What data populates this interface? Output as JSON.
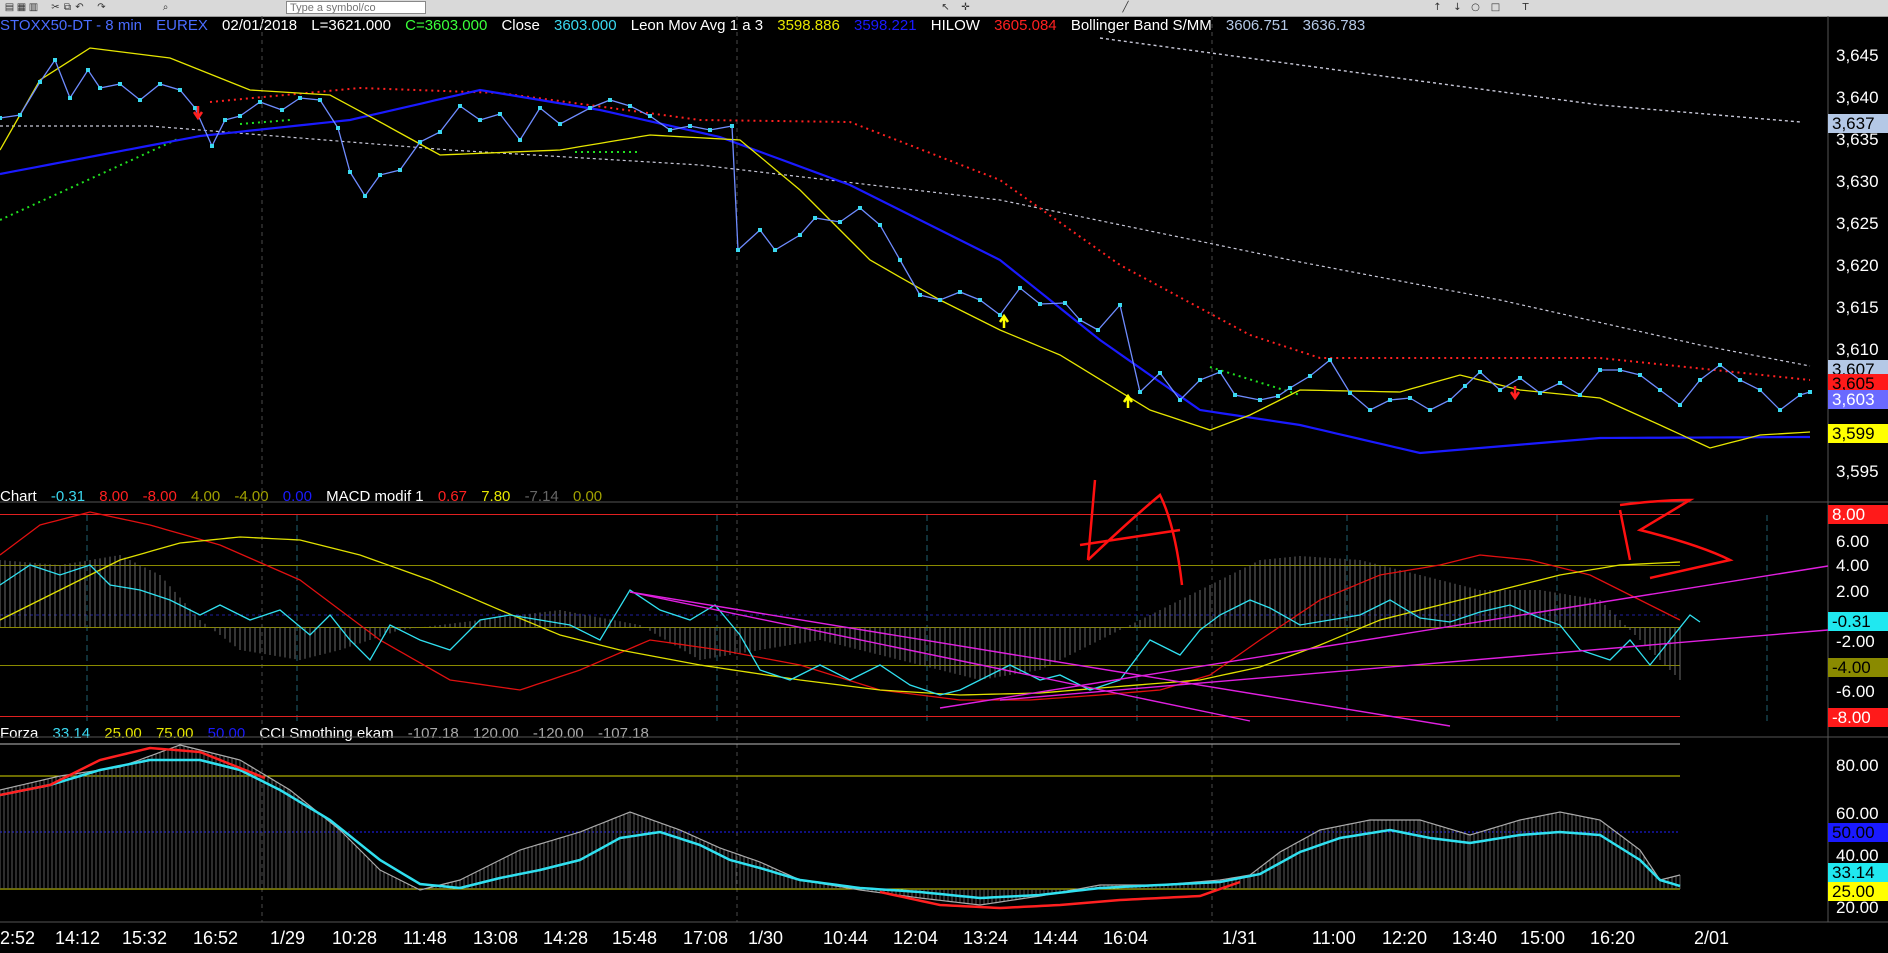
{
  "toolbar": {
    "symbol_placeholder": "Type a symbol/co",
    "tool_icons": [
      "open-icon",
      "save-icon",
      "print-icon",
      "cut-icon",
      "copy-icon",
      "undo-icon",
      "redo-icon",
      "zoom-icon",
      "cursor-icon",
      "crosshair-icon",
      "line-icon",
      "arrow-up-icon",
      "arrow-down-icon",
      "ellipse-icon",
      "rectangle-icon",
      "text-icon"
    ]
  },
  "price_header": {
    "symbol": "STOXX50-DT - 8 min",
    "exchange": "EUREX",
    "date": "02/01/2018",
    "low": "L=3621.000",
    "close_eq": "C=3603.000",
    "close_label": "Close",
    "close_value": "3603.000",
    "ma_name": "Leon Mov Avg 1 a 3",
    "ma_value1": "3598.886",
    "ma_value2": "3598.221",
    "hilow_label": "HILOW",
    "hilow_value": "3605.084",
    "bb_label": "Bollinger Band S/MM",
    "bb_value1": "3606.751",
    "bb_value2": "3636.783"
  },
  "macd_header": {
    "name": "Chart",
    "v1": "-0.31",
    "v2": "8.00",
    "v3": "-8.00",
    "v4": "4.00",
    "v5": "-4.00",
    "v6": "0.00",
    "name2": "MACD modif 1",
    "w1": "0.67",
    "w2": "7.80",
    "w3": "-7.14",
    "w4": "0.00"
  },
  "cci_header": {
    "name": "Forza",
    "v1": "33.14",
    "v2": "25.00",
    "v3": "75.00",
    "v4": "50.00",
    "name2": "CCI Smothing ekam",
    "w1": "-107.18",
    "w2": "120.00",
    "w3": "-120.00",
    "w4": "-107.18"
  },
  "price_axis": [
    "3,645",
    "3,640",
    "3,635",
    "3,630",
    "3,625",
    "3,620",
    "3,615",
    "3,610",
    "3,605",
    "3,600",
    "3,595"
  ],
  "price_badges": [
    {
      "text": "3,637",
      "bg": "#b4c8e6",
      "fg": "#000"
    },
    {
      "text": "3,607",
      "bg": "#b4c8e6",
      "fg": "#000"
    },
    {
      "text": "3,605",
      "bg": "#ff1a1a",
      "fg": "#000"
    },
    {
      "text": "3,603",
      "bg": "#6a6aff",
      "fg": "#fff"
    },
    {
      "text": "3,599",
      "bg": "#ffff00",
      "fg": "#000"
    }
  ],
  "macd_axis": [
    "8.00",
    "6.00",
    "4.00",
    "2.00",
    "-0.31",
    "-2.00",
    "-4.00",
    "-6.00",
    "-8.00"
  ],
  "cci_axis": [
    "80.00",
    "60.00",
    "50.00",
    "40.00",
    "33.14",
    "25.00",
    "20.00"
  ],
  "time_axis": [
    "2:52",
    "14:12",
    "15:32",
    "16:52",
    "1/29",
    "10:28",
    "11:48",
    "13:08",
    "14:28",
    "15:48",
    "17:08",
    "1/30",
    "10:44",
    "12:04",
    "13:24",
    "14:44",
    "16:04",
    "1/31",
    "11:00",
    "12:20",
    "13:40",
    "15:00",
    "16:20",
    "2/01"
  ],
  "annotations": {
    "left": "1A",
    "right": "B"
  },
  "colors": {
    "price_line": "#3ad8f0",
    "ma_fast": "#e6e600",
    "ma_slow": "#1a1aff",
    "hilow": "#ff2020",
    "bollinger": "#c8c8d8",
    "macd": "#e01010",
    "signal": "#e0e000",
    "trend": "#e020e0",
    "cci": "#30e0f0",
    "background": "#000000"
  }
}
